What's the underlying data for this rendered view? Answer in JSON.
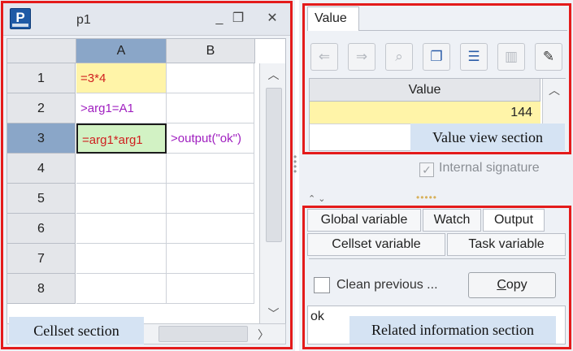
{
  "cellset": {
    "title": "p1",
    "logo_letter": "P",
    "window_buttons": [
      "_",
      "❐",
      "✕"
    ],
    "column_headers": [
      "A",
      "B"
    ],
    "selected_column": "A",
    "selected_row": "3",
    "row_headers": [
      "1",
      "2",
      "3",
      "4",
      "5",
      "6",
      "7",
      "8"
    ],
    "cells": {
      "A1": "=3*4",
      "A2": ">arg1=A1",
      "A3": "=arg1*arg1",
      "B3": ">output(\"ok\")"
    },
    "scroll_up": "︿",
    "scroll_down": "﹀",
    "scroll_right": "〉"
  },
  "value_view": {
    "tab_label": "Value",
    "toolbar": [
      {
        "icon": "arrow-left-icon",
        "glyph": "⇐",
        "enabled": false
      },
      {
        "icon": "arrow-right-icon",
        "glyph": "⇒",
        "enabled": false
      },
      {
        "icon": "zoom-icon",
        "glyph": "⌕",
        "enabled": false
      },
      {
        "icon": "copy-icon",
        "glyph": "❐",
        "enabled": true
      },
      {
        "icon": "list-icon",
        "glyph": "☰",
        "enabled": true
      },
      {
        "icon": "chart-icon",
        "glyph": "▥",
        "enabled": false
      },
      {
        "icon": "pin-icon",
        "glyph": "✎",
        "enabled": true
      }
    ],
    "table_header": "Value",
    "value": "144",
    "internal_signature_label": "Internal signature",
    "internal_signature_checked": true
  },
  "related_info": {
    "tabs_row1": [
      "Global variable",
      "Watch",
      "Output"
    ],
    "tabs_row2": [
      "Cellset variable",
      "Task variable"
    ],
    "active_tab": "Output",
    "clean_previous_label": "Clean previous ...",
    "copy_label_prefix": "",
    "copy_label_underlined": "C",
    "copy_label_rest": "opy",
    "output_text": "ok"
  },
  "callouts": {
    "cellset": "Cellset section",
    "value_view": "Value view section",
    "related": "Related information section"
  },
  "colors": {
    "highlight_red": "#e41b1b",
    "callout_bg": "#d5e3f3",
    "cell_yellow": "#fff4a8",
    "cell_green": "#d2f2c4",
    "selected_header": "#8aa6c8",
    "formula_red": "#d02020",
    "formula_purple": "#a020c0"
  }
}
